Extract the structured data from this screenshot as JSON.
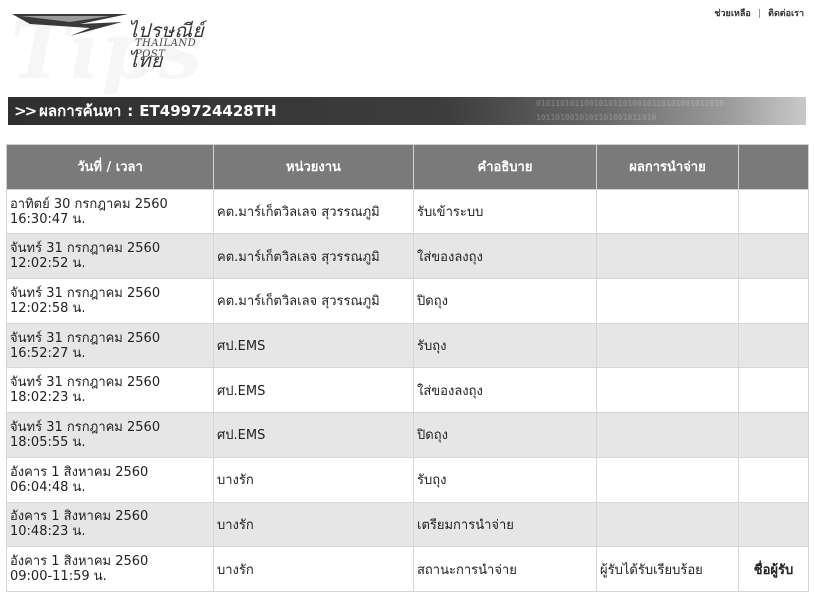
{
  "header": {
    "logo_thai": "ไปรษณีย์ไทย",
    "logo_en": "THAILAND POST",
    "watermark": "Tips",
    "links": {
      "help": "ช่วยเหลือ",
      "separator": "|",
      "contact": "ติดต่อเรา"
    }
  },
  "result": {
    "chevrons": ">>",
    "label": "ผลการค้นหา",
    "separator": ":",
    "tracking_number": "ET499724428TH",
    "binary_pattern": "0101101011001010110100101101010010110101011010010101101001011010"
  },
  "table": {
    "headers": {
      "datetime": "วันที่ / เวลา",
      "office": "หน่วยงาน",
      "description": "คำอธิบาย",
      "delivery_result": "ผลการนำจ่าย",
      "extra": ""
    },
    "rows": [
      {
        "date": "อาทิตย์ 30 กรกฎาคม 2560",
        "time": "16:30:47 น.",
        "office": "คต.มาร์เก็ตวิลเลจ สุวรรณภูมิ",
        "description": "รับเข้าระบบ",
        "result": "",
        "extra": ""
      },
      {
        "date": "จันทร์ 31 กรกฎาคม 2560",
        "time": "12:02:52 น.",
        "office": "คต.มาร์เก็ตวิลเลจ สุวรรณภูมิ",
        "description": "ใส่ของลงถุง",
        "result": "",
        "extra": ""
      },
      {
        "date": "จันทร์ 31 กรกฎาคม 2560",
        "time": "12:02:58 น.",
        "office": "คต.มาร์เก็ตวิลเลจ สุวรรณภูมิ",
        "description": "ปิดถุง",
        "result": "",
        "extra": ""
      },
      {
        "date": "จันทร์ 31 กรกฎาคม 2560",
        "time": "16:52:27 น.",
        "office": "ศป.EMS",
        "description": "รับถุง",
        "result": "",
        "extra": ""
      },
      {
        "date": "จันทร์ 31 กรกฎาคม 2560",
        "time": "18:02:23 น.",
        "office": "ศป.EMS",
        "description": "ใส่ของลงถุง",
        "result": "",
        "extra": ""
      },
      {
        "date": "จันทร์ 31 กรกฎาคม 2560",
        "time": "18:05:55 น.",
        "office": "ศป.EMS",
        "description": "ปิดถุง",
        "result": "",
        "extra": ""
      },
      {
        "date": "อังคาร 1 สิงหาคม 2560",
        "time": "06:04:48 น.",
        "office": "บางรัก",
        "description": "รับถุง",
        "result": "",
        "extra": ""
      },
      {
        "date": "อังคาร 1 สิงหาคม 2560",
        "time": "10:48:23 น.",
        "office": "บางรัก",
        "description": "เตรียมการนำจ่าย",
        "result": "",
        "extra": ""
      },
      {
        "date": "อังคาร 1 สิงหาคม 2560",
        "time": "09:00-11:59 น.",
        "office": "บางรัก",
        "description": "สถานะการนำจ่าย",
        "result": "ผู้รับได้รับเรียบร้อย",
        "extra": "ชื่อผู้รับ"
      }
    ]
  }
}
